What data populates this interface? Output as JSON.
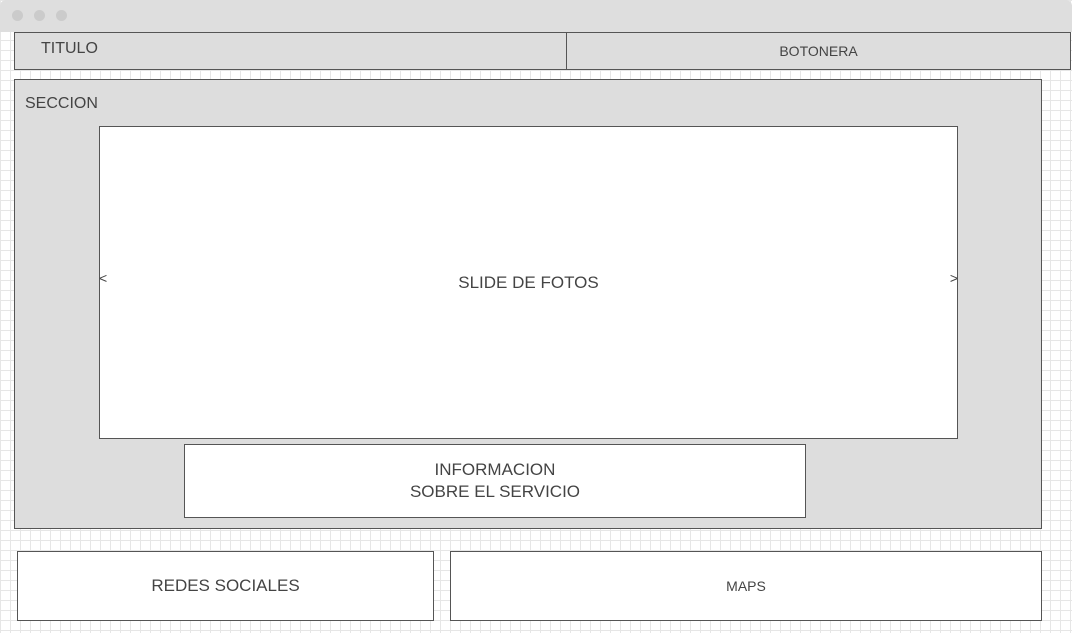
{
  "window": {
    "controls": [
      "close-dot-icon",
      "minimize-dot-icon",
      "maximize-dot-icon"
    ]
  },
  "header": {
    "title": "TITULO",
    "buttons": "BOTONERA"
  },
  "section": {
    "label": "SECCION",
    "slider": {
      "label": "SLIDE DE FOTOS",
      "prev": "<",
      "next": ">"
    },
    "info": {
      "line1": "INFORMACION",
      "line2": "SOBRE EL SERVICIO"
    }
  },
  "footer": {
    "social": "REDES SOCIALES",
    "maps": "MAPS"
  },
  "colors": {
    "panel": "#dddddd",
    "border": "#555555",
    "grid": "#e6e6e6",
    "text": "#444444"
  }
}
